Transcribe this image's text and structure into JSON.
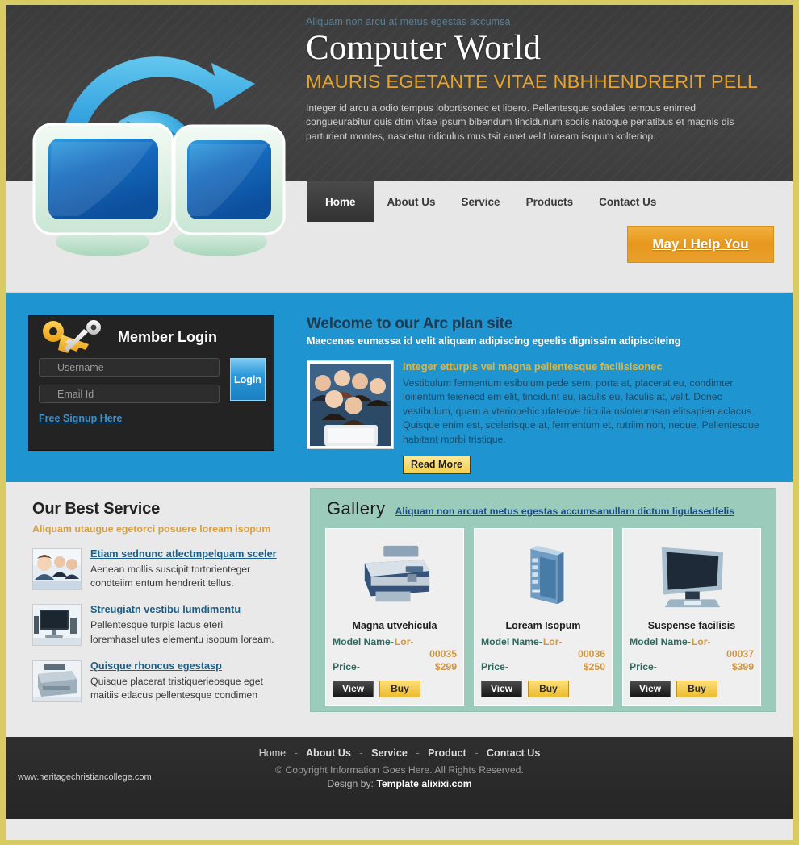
{
  "header": {
    "tagline": "Aliquam non arcu at metus egestas accumsa",
    "brand": "Computer World",
    "subhead": "MAURIS EGETANTE VITAE NBHHENDRERIT PELL",
    "paragraph": "Integer id arcu a odio tempus lobortisonec et libero. Pellentesque sodales tempus enimed congueurabitur quis dtim vitae ipsum bibendum tincidunum sociis natoque penatibus et magnis dis parturient montes, nascetur ridiculus mus tsit amet velit loream isopum kolteriop.",
    "logo_icon": "two-monitors-globe-network-icon"
  },
  "nav": {
    "items": [
      {
        "label": "Home",
        "active": true
      },
      {
        "label": "About Us",
        "active": false
      },
      {
        "label": "Service",
        "active": false
      },
      {
        "label": "Products",
        "active": false
      },
      {
        "label": "Contact Us",
        "active": false
      }
    ],
    "help_button": "May I Help You"
  },
  "login": {
    "title": "Member Login",
    "icon": "key-icon",
    "username_placeholder": "Username",
    "username_value": "",
    "email_placeholder": "Email Id",
    "email_value": "",
    "login_button": "Login",
    "signup_link": "Free Signup Here"
  },
  "welcome": {
    "heading": "Welcome to our Arc plan site",
    "subheading": "Maecenas eumassa id velit aliquam adipiscing egeelis dignissim adipisciteing",
    "photo_icon": "group-of-people-photo",
    "article_title": "Integer etturpis vel magna pellentesque facilisisonec",
    "article_body": "Vestibulum fermentum esibulum pede sem, porta at, placerat eu, condimter loiiientum teienecd em elit, tincidunt eu, iaculis eu, Iaculis at, velit. Donec vestibulum, quam a vteriopehic ufateove hicuila nsloteumsan elitsapien aclacus Quisque enim est, scelerisque at, fermentum et, rutriim non, neque. Pellentesque habitant morbi tristique.",
    "read_more": "Read More"
  },
  "services": {
    "heading": "Our Best Service",
    "subheading": "Aliquam utaugue egetorci posuere loream isopum",
    "items": [
      {
        "icon": "business-team-photo",
        "link": "Etiam sednunc atlectmpelquam sceler",
        "text": "Aenean mollis suscipit tortorienteger condteiim entum hendrerit tellus."
      },
      {
        "icon": "desktop-computer-photo",
        "link": "Streugiatn vestibu lumdimentu",
        "text": "Pellentesque turpis lacus eteri loremhasellutes elementu isopum loream."
      },
      {
        "icon": "printer-photo",
        "link": "Quisque rhoncus egestasp",
        "text": "Quisque placerat tristiquerieosque eget maitiis etlacus pellentesque condimen"
      }
    ]
  },
  "gallery": {
    "title": "Gallery",
    "link": "Aliquam non arcuat metus egestas accumsanullam dictum ligulasedfelis",
    "model_label": "Model Name-",
    "price_label": "Price-",
    "view_button": "View",
    "buy_button": "Buy",
    "products": [
      {
        "image_icon": "inkjet-printer-icon",
        "name": "Magna utvehicula",
        "model_prefix": "Lor-",
        "model_number": "00035",
        "price": "$299"
      },
      {
        "image_icon": "computer-tower-icon",
        "name": "Loream Isopum",
        "model_prefix": "Lor-",
        "model_number": "00036",
        "price": "$250"
      },
      {
        "image_icon": "lcd-monitor-icon",
        "name": "Suspense facilisis",
        "model_prefix": "Lor-",
        "model_number": "00037",
        "price": "$399"
      }
    ]
  },
  "footer": {
    "links": [
      "Home",
      "About Us",
      "Service",
      "Product",
      "Contact Us"
    ],
    "separator": "-",
    "copyright": "© Copyright Information Goes Here. All Rights Reserved.",
    "design_prefix": "Design by:",
    "design_name": "Template alixixi.com",
    "site": "www.heritagechristiancollege.com"
  },
  "colors": {
    "page_border": "#d9cb63",
    "header_bg": "#3f3f3f",
    "accent_orange": "#e8a32b",
    "blue_band": "#1e95d0",
    "gallery_green": "#9bcbbb",
    "footer_bg": "#2b2b2b"
  }
}
